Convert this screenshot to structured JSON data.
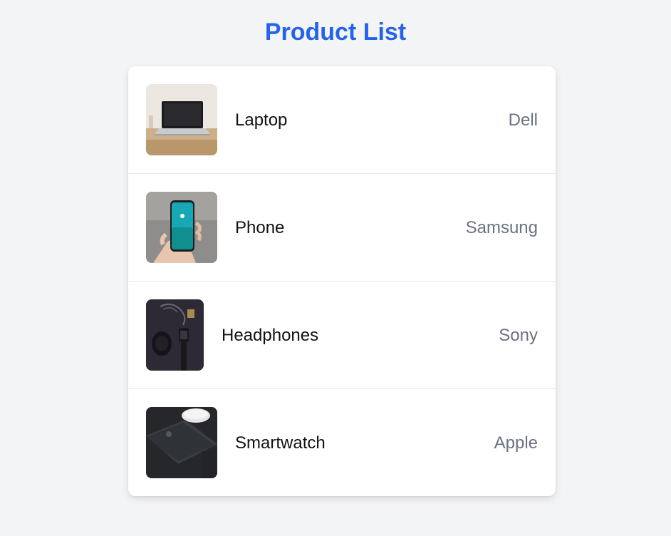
{
  "page": {
    "title": "Product List"
  },
  "products": [
    {
      "name": "Laptop",
      "brand": "Dell",
      "image_icon": "laptop-photo-icon"
    },
    {
      "name": "Phone",
      "brand": "Samsung",
      "image_icon": "phone-photo-icon"
    },
    {
      "name": "Headphones",
      "brand": "Sony",
      "image_icon": "headphones-photo-icon"
    },
    {
      "name": "Smartwatch",
      "brand": "Apple",
      "image_icon": "smartwatch-photo-icon"
    }
  ],
  "colors": {
    "title": "#2563eb",
    "background": "#f3f4f6",
    "brand_text": "#6b7280",
    "divider": "#e5e7eb"
  }
}
